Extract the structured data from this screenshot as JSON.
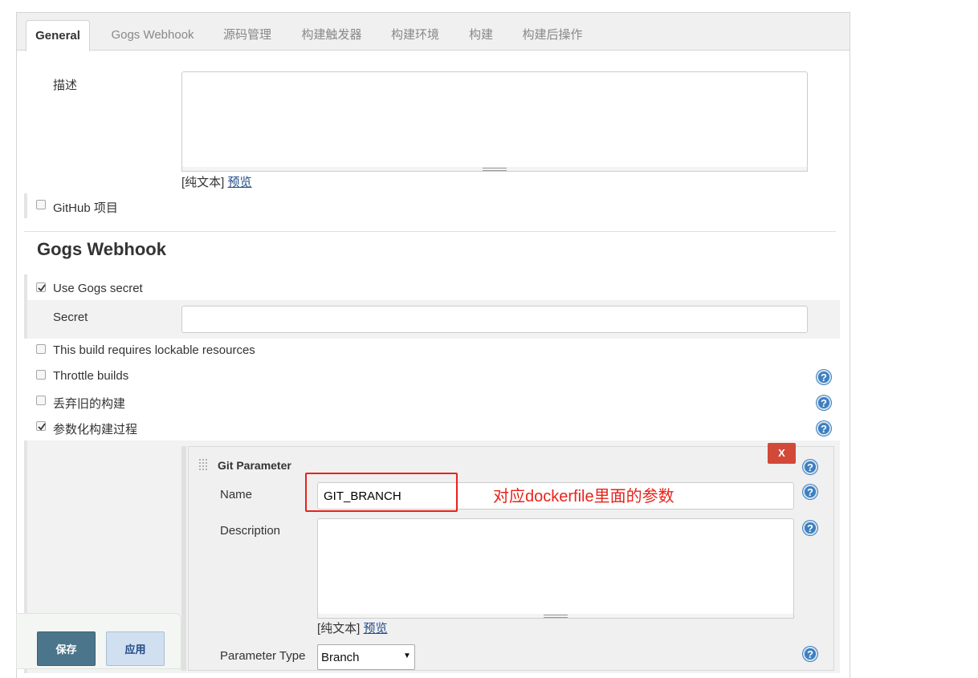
{
  "tabs": [
    "General",
    "Gogs Webhook",
    "源码管理",
    "构建触发器",
    "构建环境",
    "构建",
    "构建后操作"
  ],
  "general": {
    "description_label": "描述",
    "description_value": "",
    "plain_text": "[纯文本]",
    "preview": "预览",
    "github_project_label": "GitHub 项目",
    "github_project_checked": false
  },
  "gogs": {
    "section_title": "Gogs Webhook",
    "use_secret_label": "Use Gogs secret",
    "use_secret_checked": true,
    "secret_label": "Secret",
    "secret_value": ""
  },
  "options": [
    {
      "label": "This build requires lockable resources",
      "checked": false,
      "help": false
    },
    {
      "label": "Throttle builds",
      "checked": false,
      "help": true
    },
    {
      "label": "丢弃旧的构建",
      "checked": false,
      "help": true
    },
    {
      "label": "参数化构建过程",
      "checked": true,
      "help": true
    }
  ],
  "git_parameter": {
    "title": "Git Parameter",
    "delete_label": "X",
    "name_label": "Name",
    "name_value": "GIT_BRANCH",
    "annotation": "对应dockerfile里面的参数",
    "description_label": "Description",
    "description_value": "",
    "plain_text": "[纯文本]",
    "preview": "预览",
    "param_type_label": "Parameter Type",
    "param_type_value": "Branch"
  },
  "footer": {
    "save_label": "保存",
    "apply_label": "应用"
  },
  "icons": {
    "help": "help-icon",
    "drag": "drag-handle-icon",
    "dropdown": "caret-down-icon"
  },
  "colors": {
    "help_blue": "#3d7fbf",
    "delete_red": "#d24939",
    "annotation_red": "#e8231b",
    "save_button": "#4b758b",
    "apply_button": "#d1e0f0"
  }
}
